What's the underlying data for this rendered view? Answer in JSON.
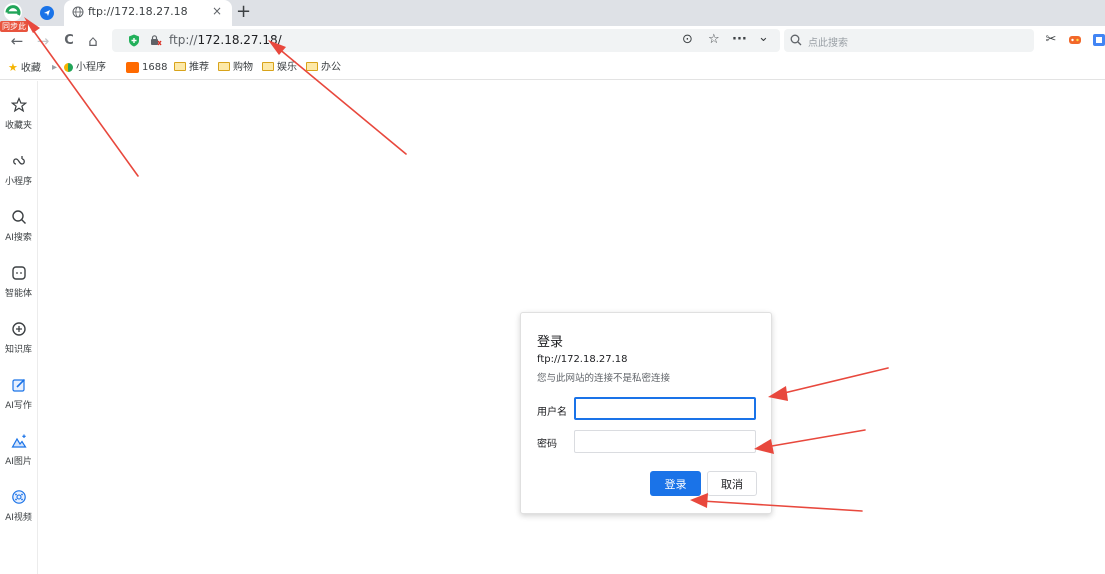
{
  "browser": {
    "sync_badge": "同步此",
    "tab": {
      "title": "ftp://172.18.27.18",
      "close": "×"
    },
    "new_tab": "+",
    "toolbar": {
      "back": "←",
      "forward": "→",
      "reload": "C",
      "home": "⌂"
    },
    "address": {
      "scheme": "ftp://",
      "host": "172.18.27.18/"
    },
    "omnibox_actions": {
      "reader": "⊙",
      "star": "☆",
      "more": "···",
      "dropdown": "⌄"
    },
    "search": {
      "placeholder": "点此搜索"
    },
    "bookmarks": [
      {
        "label": "收藏",
        "icon": "star-icon"
      },
      {
        "label": "小程序",
        "icon": "miniprogram-icon"
      },
      {
        "label": "1688",
        "icon": "1688-icon"
      },
      {
        "label": "推荐",
        "icon": "folder-icon"
      },
      {
        "label": "购物",
        "icon": "folder-icon"
      },
      {
        "label": "娱乐",
        "icon": "folder-icon"
      },
      {
        "label": "办公",
        "icon": "folder-icon"
      }
    ]
  },
  "sidebar": {
    "items": [
      {
        "label": "收藏夹",
        "icon": "star-icon"
      },
      {
        "label": "小程序",
        "icon": "link-icon"
      },
      {
        "label": "AI搜索",
        "icon": "search-icon"
      },
      {
        "label": "智能体",
        "icon": "agent-icon"
      },
      {
        "label": "知识库",
        "icon": "knowledge-icon"
      },
      {
        "label": "AI写作",
        "icon": "write-icon"
      },
      {
        "label": "AI图片",
        "icon": "image-icon"
      },
      {
        "label": "AI视频",
        "icon": "video-icon"
      }
    ]
  },
  "dialog": {
    "title": "登录",
    "url": "ftp://172.18.27.18",
    "note": "您与此网站的连接不是私密连接",
    "username_label": "用户名",
    "username_value": "",
    "password_label": "密码",
    "password_value": "",
    "login_button": "登录",
    "cancel_button": "取消"
  },
  "colors": {
    "accent": "#1a73e8",
    "annotation_arrow": "#e8483d",
    "tabstrip": "#dee1e6"
  }
}
